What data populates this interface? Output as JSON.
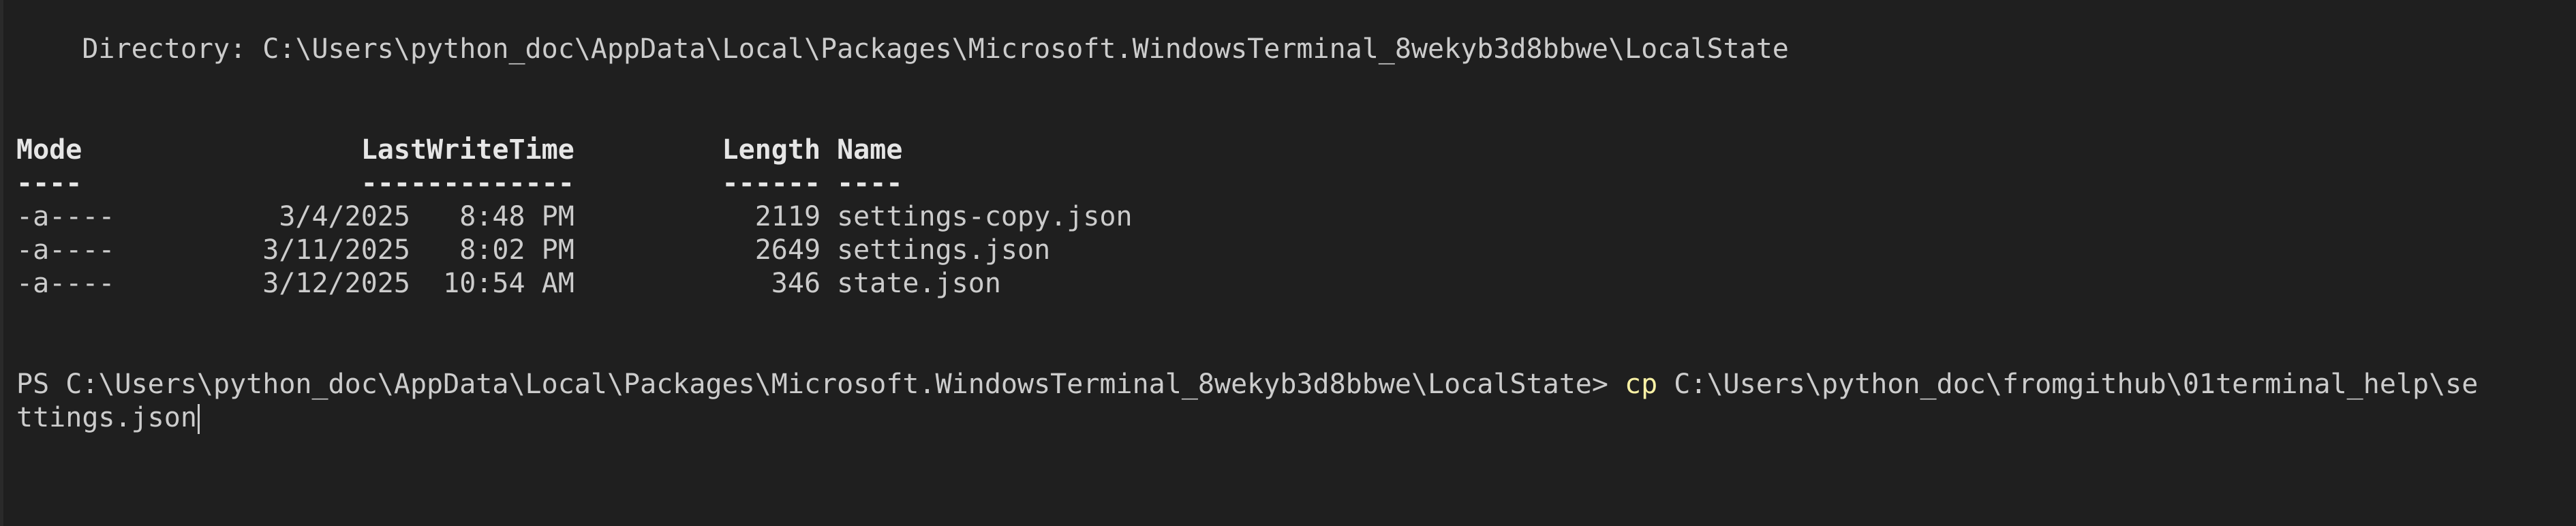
{
  "directory_line": "    Directory: C:\\Users\\python_doc\\AppData\\Local\\Packages\\Microsoft.WindowsTerminal_8wekyb3d8bbwe\\LocalState",
  "table": {
    "header": "Mode                 LastWriteTime         Length Name",
    "underline": "----                 -------------         ------ ----",
    "rows": [
      "-a----          3/4/2025   8:48 PM           2119 settings-copy.json",
      "-a----         3/11/2025   8:02 PM           2649 settings.json",
      "-a----         3/12/2025  10:54 AM            346 state.json"
    ]
  },
  "prompt": {
    "text": "PS C:\\Users\\python_doc\\AppData\\Local\\Packages\\Microsoft.WindowsTerminal_8wekyb3d8bbwe\\LocalState> ",
    "command": "cp",
    "argument_part1": " C:\\Users\\python_doc\\fromgithub\\01terminal_help\\se",
    "argument_part2": "ttings.json"
  },
  "colors": {
    "background": "#1f1f1f",
    "foreground": "#cccccc",
    "command": "#f9f1a5"
  }
}
